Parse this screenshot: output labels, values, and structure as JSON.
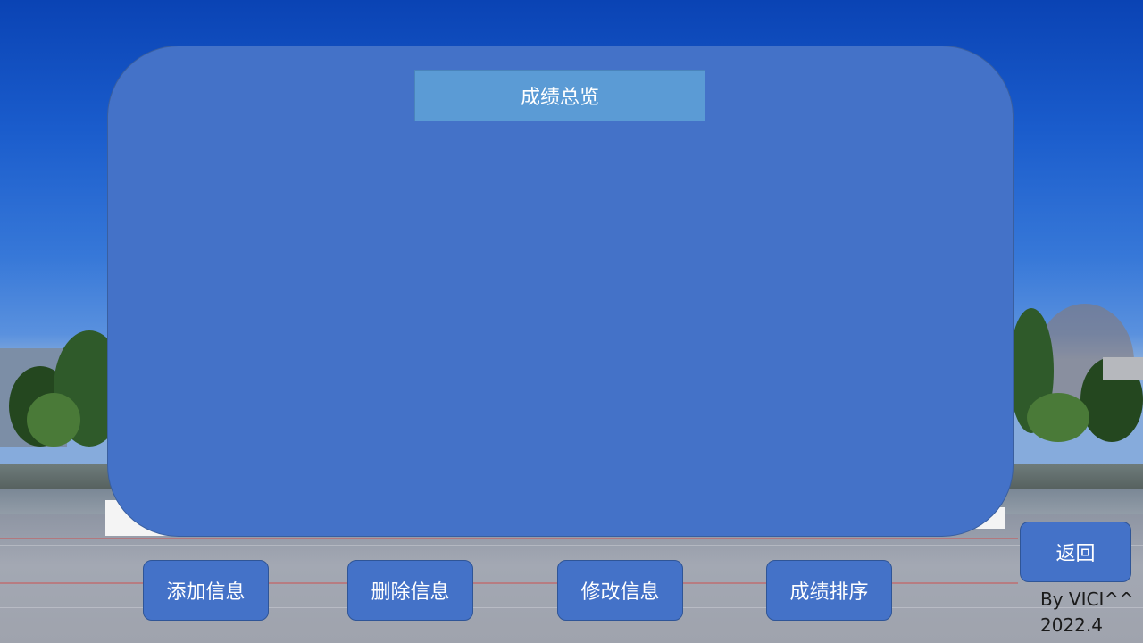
{
  "panel": {
    "title": "成绩总览"
  },
  "actions": {
    "add_label": "添加信息",
    "delete_label": "删除信息",
    "edit_label": "修改信息",
    "sort_label": "成绩排序",
    "back_label": "返回"
  },
  "credit": {
    "author": "By VICI^^",
    "date": "2022.4"
  },
  "colors": {
    "panel": "#4472c8",
    "title_bar": "#5b9bd5",
    "button": "#4472c8",
    "text": "#ffffff"
  }
}
